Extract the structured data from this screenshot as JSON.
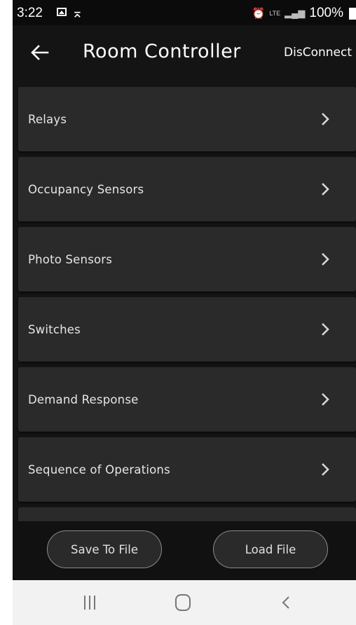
{
  "status_bar": {
    "time": "3:22",
    "network": "LTE",
    "battery": "100%"
  },
  "toolbar": {
    "title": "Room Controller",
    "disconnect_label": "DisConnect"
  },
  "menu": {
    "items": [
      {
        "label": "Relays"
      },
      {
        "label": "Occupancy Sensors"
      },
      {
        "label": "Photo Sensors"
      },
      {
        "label": "Switches"
      },
      {
        "label": "Demand Response"
      },
      {
        "label": "Sequence of Operations"
      }
    ]
  },
  "actions": {
    "save_label": "Save To File",
    "load_label": "Load File"
  },
  "colors": {
    "background": "#141414",
    "card": "#2a2a2a",
    "text": "#e6e6e6",
    "nav_bar": "#f2f2f2"
  }
}
